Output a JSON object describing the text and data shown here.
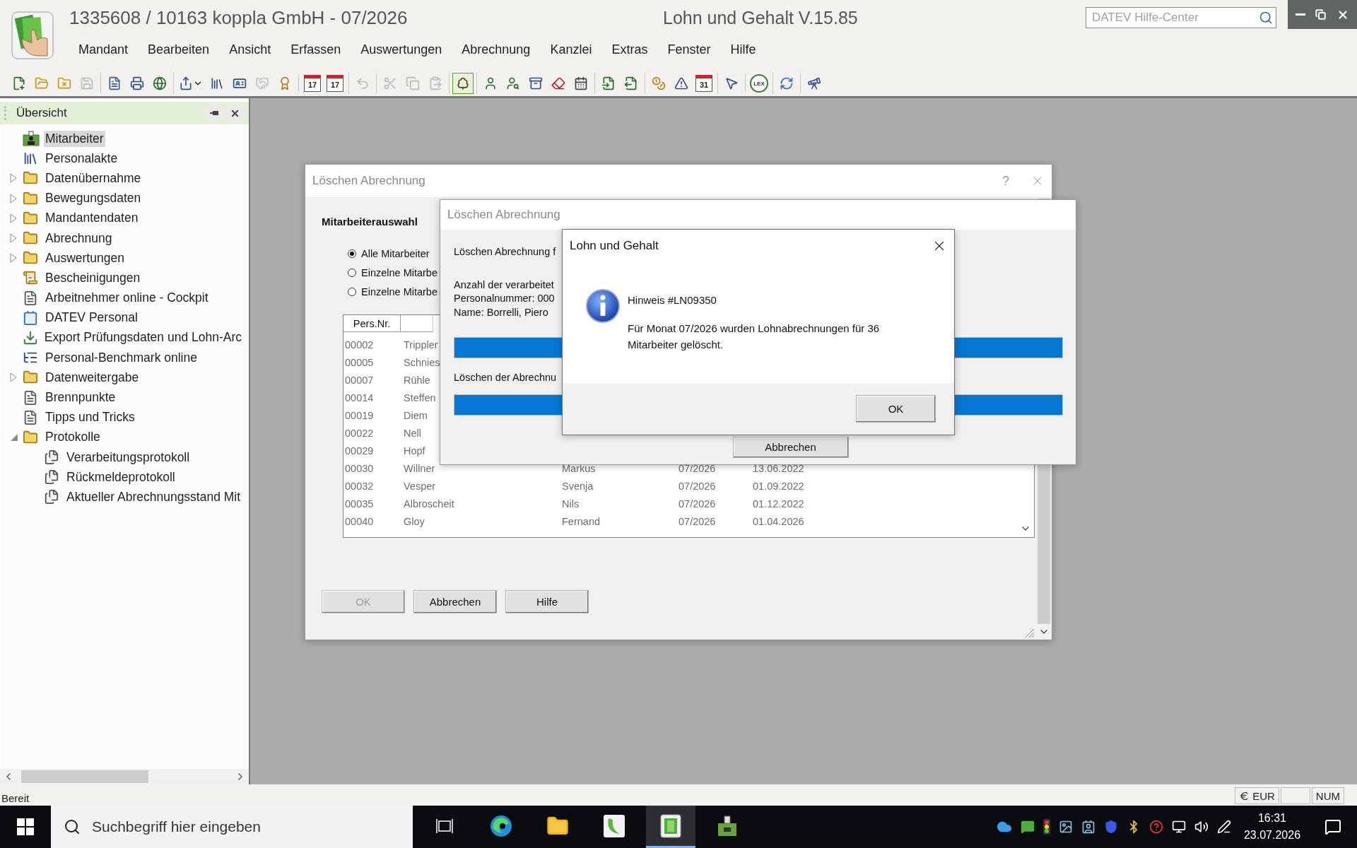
{
  "app": {
    "title": "1335608 / 10163 koppla GmbH - 07/2026",
    "product": "Lohn und Gehalt V.15.85",
    "help_search": {
      "placeholder": "DATEV Hilfe-Center"
    }
  },
  "menu": [
    "Mandant",
    "Bearbeiten",
    "Ansicht",
    "Erfassen",
    "Auswertungen",
    "Abrechnung",
    "Kanzlei",
    "Extras",
    "Fenster",
    "Hilfe"
  ],
  "toolbar": [
    [
      {
        "kind": "new-file",
        "selected": false,
        "disabled": false
      },
      {
        "kind": "open-folder",
        "selected": false,
        "disabled": false
      },
      {
        "kind": "folder-x",
        "selected": false,
        "disabled": false
      },
      {
        "kind": "save",
        "selected": false,
        "disabled": true
      }
    ],
    [
      {
        "kind": "preview",
        "selected": false,
        "disabled": false
      },
      {
        "kind": "printer",
        "selected": false,
        "disabled": false
      },
      {
        "kind": "globe",
        "selected": false,
        "disabled": false
      }
    ],
    [
      {
        "kind": "export",
        "selected": false,
        "disabled": false
      },
      {
        "kind": "binder",
        "selected": false,
        "disabled": false
      },
      {
        "kind": "card",
        "selected": false,
        "disabled": false
      },
      {
        "kind": "handshake",
        "selected": false,
        "disabled": true
      },
      {
        "kind": "certificate",
        "selected": false,
        "disabled": false
      }
    ],
    [
      {
        "kind": "calendar",
        "text": "17",
        "selected": false,
        "disabled": false
      },
      {
        "kind": "calendar",
        "text": "17",
        "selected": false,
        "disabled": false
      }
    ],
    [
      {
        "kind": "undo",
        "selected": false,
        "disabled": true
      }
    ],
    [
      {
        "kind": "cut",
        "selected": false,
        "disabled": true
      },
      {
        "kind": "copy",
        "selected": false,
        "disabled": true
      },
      {
        "kind": "paste",
        "selected": false,
        "disabled": true
      }
    ],
    [
      {
        "kind": "tree",
        "selected": true,
        "disabled": false
      }
    ],
    [
      {
        "kind": "person",
        "selected": false,
        "disabled": false
      },
      {
        "kind": "person-search",
        "selected": false,
        "disabled": false
      },
      {
        "kind": "archive",
        "selected": false,
        "disabled": false
      },
      {
        "kind": "eraser",
        "selected": false,
        "disabled": false
      },
      {
        "kind": "calendar-days",
        "selected": false,
        "disabled": false
      }
    ],
    [
      {
        "kind": "file-in",
        "selected": false,
        "disabled": false
      },
      {
        "kind": "file-out",
        "selected": false,
        "disabled": false
      }
    ],
    [
      {
        "kind": "coins",
        "selected": false,
        "disabled": false
      },
      {
        "kind": "alert",
        "selected": false,
        "disabled": false
      },
      {
        "kind": "calendar",
        "text": "31",
        "selected": false,
        "disabled": false
      }
    ],
    [
      {
        "kind": "cursor",
        "selected": false,
        "disabled": false
      }
    ],
    [
      {
        "kind": "lex",
        "text": "LEX",
        "selected": false,
        "disabled": false
      }
    ],
    [
      {
        "kind": "refresh",
        "selected": false,
        "disabled": false
      }
    ],
    [
      {
        "kind": "telescope",
        "selected": false,
        "disabled": false
      }
    ]
  ],
  "sidebar": {
    "title": "Übersicht",
    "items": [
      {
        "label": "Mitarbeiter",
        "kind": "team",
        "selected": true
      },
      {
        "label": "Personalakte",
        "kind": "binder",
        "selected": false
      },
      {
        "label": "Datenübernahme",
        "kind": "folder",
        "expanded": false,
        "selected": false
      },
      {
        "label": "Bewegungsdaten",
        "kind": "folder",
        "expanded": false,
        "selected": false
      },
      {
        "label": "Mandantendaten",
        "kind": "folder",
        "expanded": false,
        "selected": false
      },
      {
        "label": "Abrechnung",
        "kind": "folder",
        "expanded": false,
        "selected": false
      },
      {
        "label": "Auswertungen",
        "kind": "folder",
        "expanded": false,
        "selected": false
      },
      {
        "label": "Bescheinigungen",
        "kind": "certificate",
        "selected": false
      },
      {
        "label": "Arbeitnehmer online - Cockpit",
        "kind": "document",
        "selected": false
      },
      {
        "label": "DATEV Personal",
        "kind": "contact",
        "selected": false
      },
      {
        "label": "Export Prüfungsdaten und Lohn-Arc",
        "kind": "download",
        "selected": false
      },
      {
        "label": "Personal-Benchmark online",
        "kind": "benchmark",
        "selected": false
      },
      {
        "label": "Datenweitergabe",
        "kind": "folder",
        "expanded": false,
        "selected": false
      },
      {
        "label": "Brennpunkte",
        "kind": "document",
        "selected": false
      },
      {
        "label": "Tipps und Tricks",
        "kind": "document",
        "selected": false
      },
      {
        "label": "Protokolle",
        "kind": "folder",
        "expanded": true,
        "selected": false,
        "children": [
          {
            "label": "Verarbeitungsprotokoll",
            "kind": "protocol",
            "selected": false
          },
          {
            "label": "Rückmeldeprotokoll",
            "kind": "protocol",
            "selected": false
          },
          {
            "label": "Aktueller Abrechnungsstand Mit",
            "kind": "protocol",
            "selected": false
          }
        ]
      }
    ]
  },
  "dialog_selection": {
    "title": "Löschen Abrechnung",
    "help": "?",
    "heading": "Mitarbeiterauswahl",
    "options": [
      {
        "label": "Alle Mitarbeiter",
        "selected": true
      },
      {
        "label": "Einzelne Mitarbe",
        "selected": false
      },
      {
        "label": "Einzelne Mitarbe",
        "selected": false
      }
    ],
    "table": {
      "columns": [
        "Pers.Nr."
      ],
      "rows": [
        [
          "00002",
          "Trippler"
        ],
        [
          "00005",
          "Schnies"
        ],
        [
          "00007",
          "Rühle"
        ],
        [
          "00014",
          "Steffen"
        ],
        [
          "00019",
          "Diem"
        ],
        [
          "00022",
          "Nell"
        ],
        [
          "00029",
          "Hopf"
        ],
        [
          "00030",
          "Willner",
          "Markus",
          "07/2026",
          "13.06.2022"
        ],
        [
          "00032",
          "Vesper",
          "Svenja",
          "07/2026",
          "01.09.2022"
        ],
        [
          "00035",
          "Albroscheit",
          "Nils",
          "07/2026",
          "01.12.2022"
        ],
        [
          "00040",
          "Gloy",
          "Fernand",
          "07/2026",
          "01.04.2026"
        ]
      ]
    },
    "buttons": [
      {
        "label": "OK",
        "disabled": true
      },
      {
        "label": "Abbrechen",
        "disabled": false
      },
      {
        "label": "Hilfe",
        "disabled": false
      }
    ]
  },
  "dialog_progress": {
    "title": "Löschen Abrechnung",
    "line": "Löschen Abrechnung f",
    "details": [
      "Anzahl der verarbeitet",
      "Personalnummer: 000",
      "Name: Borrelli, Piero"
    ],
    "progress_1": {
      "level": 1
    },
    "label_2": "Löschen der Abrechnu",
    "progress_2": {
      "level": 1
    },
    "cancel": "Abbrechen"
  },
  "message_box": {
    "title": "Lohn und Gehalt",
    "heading": "Hinweis #LN09350",
    "message": "Für Monat 07/2026 wurden Lohnabrechnungen für 36 Mitarbeiter gelöscht.",
    "ok": "OK"
  },
  "status_bar": {
    "text": "Bereit",
    "currency": "EUR",
    "num": "NUM"
  },
  "taskbar": {
    "search": {
      "placeholder": "Suchbegriff hier eingeben"
    },
    "apps": [
      {
        "kind": "task-view",
        "active": false
      },
      {
        "kind": "edge",
        "active": false
      },
      {
        "kind": "explorer",
        "active": false
      },
      {
        "kind": "swirl",
        "active": false
      },
      {
        "kind": "payroll",
        "active": true
      },
      {
        "kind": "scanner",
        "active": false
      }
    ],
    "time": "16:31",
    "date": "23.07.2026"
  }
}
